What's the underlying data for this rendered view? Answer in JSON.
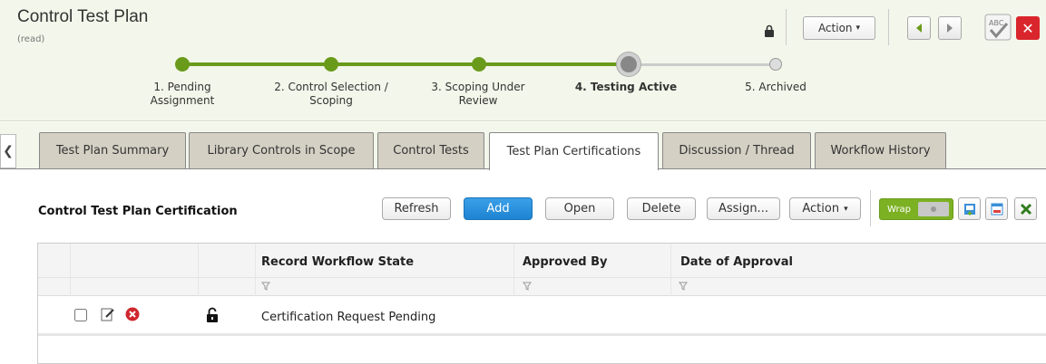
{
  "header": {
    "title": "Control Test Plan",
    "mode": "(read)",
    "action_label": "Action",
    "action_caret": "▾",
    "close_glyph": "✕",
    "spell_text": "ABC"
  },
  "workflow": {
    "steps": [
      {
        "line1": "1. Pending",
        "line2": "Assignment",
        "state": "done"
      },
      {
        "line1": "2. Control Selection /",
        "line2": "Scoping",
        "state": "done"
      },
      {
        "line1": "3. Scoping Under",
        "line2": "Review",
        "state": "done"
      },
      {
        "line1": "4. Testing Active",
        "line2": "",
        "state": "current"
      },
      {
        "line1": "5. Archived",
        "line2": "",
        "state": "future"
      }
    ]
  },
  "tabs": {
    "back_glyph": "❮",
    "items": [
      {
        "label": "Test Plan Summary"
      },
      {
        "label": "Library Controls in Scope"
      },
      {
        "label": "Control Tests"
      },
      {
        "label": "Test Plan Certifications",
        "active": true
      },
      {
        "label": "Discussion / Thread"
      },
      {
        "label": "Workflow History"
      }
    ]
  },
  "section": {
    "title": "Control Test Plan Certification",
    "buttons": {
      "refresh": "Refresh",
      "add": "Add",
      "open": "Open",
      "delete": "Delete",
      "assign": "Assign...",
      "action": "Action",
      "action_caret": "▾"
    },
    "wrap_label": "Wrap"
  },
  "grid": {
    "columns": [
      "Record Workflow State",
      "Approved By",
      "Date of Approval"
    ],
    "rows": [
      {
        "record_workflow_state": "Certification Request Pending",
        "approved_by": "",
        "date_of_approval": ""
      }
    ]
  },
  "colors": {
    "accent_green": "#6a9a1a",
    "primary_blue": "#1e84d2",
    "close_red": "#d9262d",
    "header_bg": "#f3f6ea"
  }
}
